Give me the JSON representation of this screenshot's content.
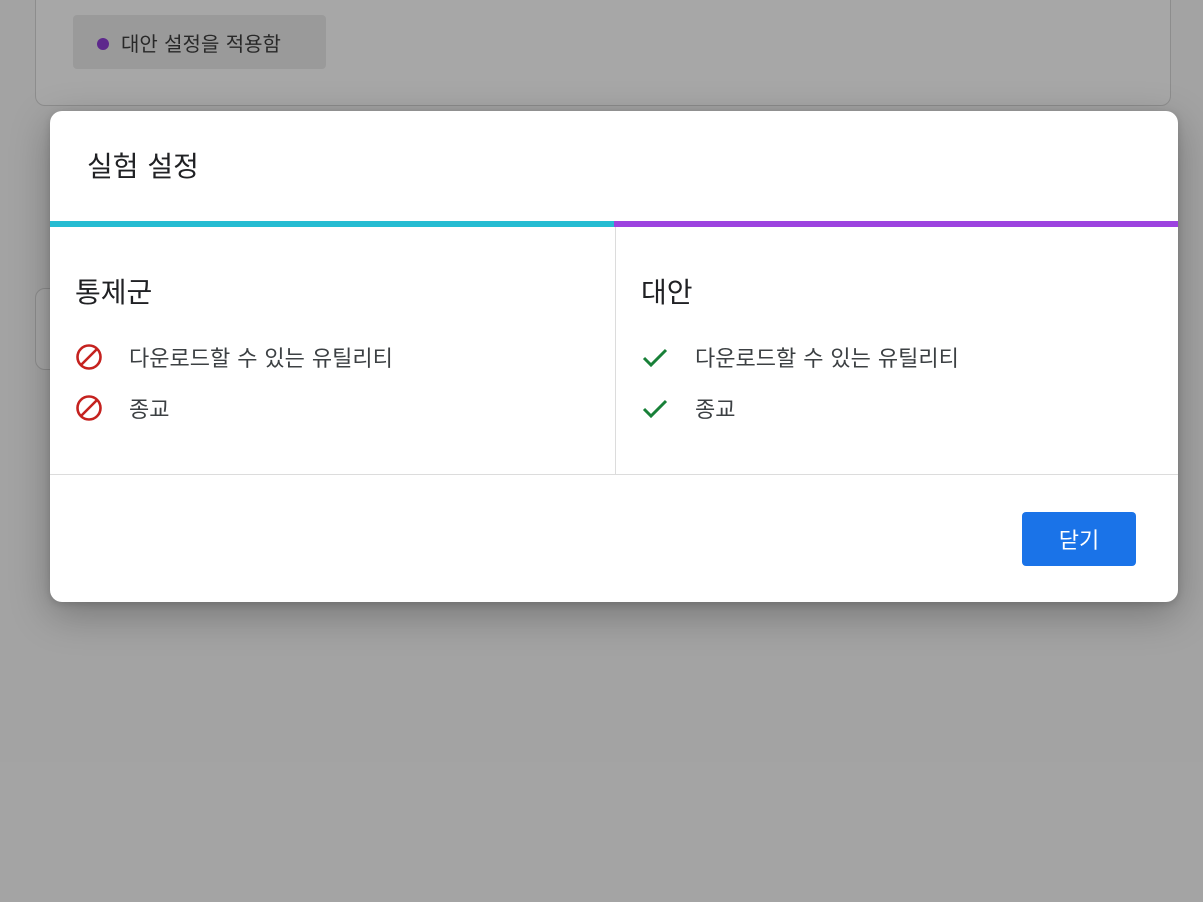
{
  "background": {
    "chip_label": "대안 설정을 적용함",
    "chip_dot_color": "#8a3ccf"
  },
  "dialog": {
    "title": "실험 설정",
    "control": {
      "title": "통제군",
      "accent_color": "#26bcd2",
      "features": [
        {
          "label": "다운로드할 수 있는 유틸리티",
          "icon": "block-icon",
          "enabled": false
        },
        {
          "label": "종교",
          "icon": "block-icon",
          "enabled": false
        }
      ]
    },
    "variant": {
      "title": "대안",
      "accent_color": "#9c43df",
      "features": [
        {
          "label": "다운로드할 수 있는 유틸리티",
          "icon": "check-icon",
          "enabled": true
        },
        {
          "label": "종교",
          "icon": "check-icon",
          "enabled": true
        }
      ]
    },
    "close_label": "닫기",
    "colors": {
      "primary_button": "#1a73e8",
      "disabled_icon": "#c5221f",
      "enabled_icon": "#188038"
    }
  }
}
